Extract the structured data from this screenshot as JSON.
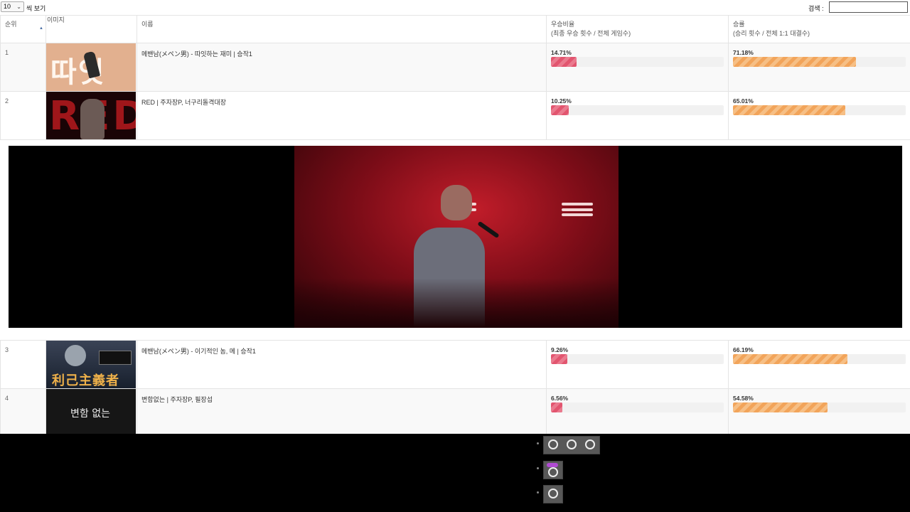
{
  "controls": {
    "page_size": "10",
    "page_size_suffix": "씩 보기",
    "search_label": "검색 :",
    "search_value": ""
  },
  "table": {
    "headers": {
      "rank": "순위",
      "image": "이미지",
      "name": "이름",
      "win_ratio_line1": "우승비율",
      "win_ratio_line2": "(최종 우승 횟수 / 전체 게임수)",
      "win_rate_line1": "승률",
      "win_rate_line2": "(승리 횟수 / 전체 1:1 대결수)"
    },
    "sort": {
      "column": "rank",
      "direction": "ascending"
    },
    "rows": [
      {
        "rank": "1",
        "name": "메밴남(メペン男) - 따잇하는 재미 | 승작1",
        "thumb_text": "따잇",
        "win_ratio": "14.71%",
        "win_ratio_value": 14.71,
        "win_rate": "71.18%",
        "win_rate_value": 71.18
      },
      {
        "rank": "2",
        "name": "RED | 주자장P, 너구리돌격대장",
        "thumb_text": "RED",
        "win_ratio": "10.25%",
        "win_ratio_value": 10.25,
        "win_rate": "65.01%",
        "win_rate_value": 65.01
      },
      {
        "rank": "3",
        "name": "메밴남(メペン男) - 이기적인 놈, 메 | 승작1",
        "thumb_text": "利己主義者",
        "win_ratio": "9.26%",
        "win_ratio_value": 9.26,
        "win_rate": "66.19%",
        "win_rate_value": 66.19
      },
      {
        "rank": "4",
        "name": "변함없는 | 주자장P, 필장섭",
        "thumb_text": "변함 없는",
        "win_ratio": "6.56%",
        "win_ratio_value": 6.56,
        "win_rate": "54.58%",
        "win_rate_value": 54.58
      }
    ]
  },
  "colors": {
    "win_ratio_bar": "#e2556f",
    "win_rate_bar": "#f2a45a",
    "video_background": "#000000"
  },
  "icons": {
    "sort": "sort-ascending-icon",
    "select": "chevron-down-icon"
  }
}
